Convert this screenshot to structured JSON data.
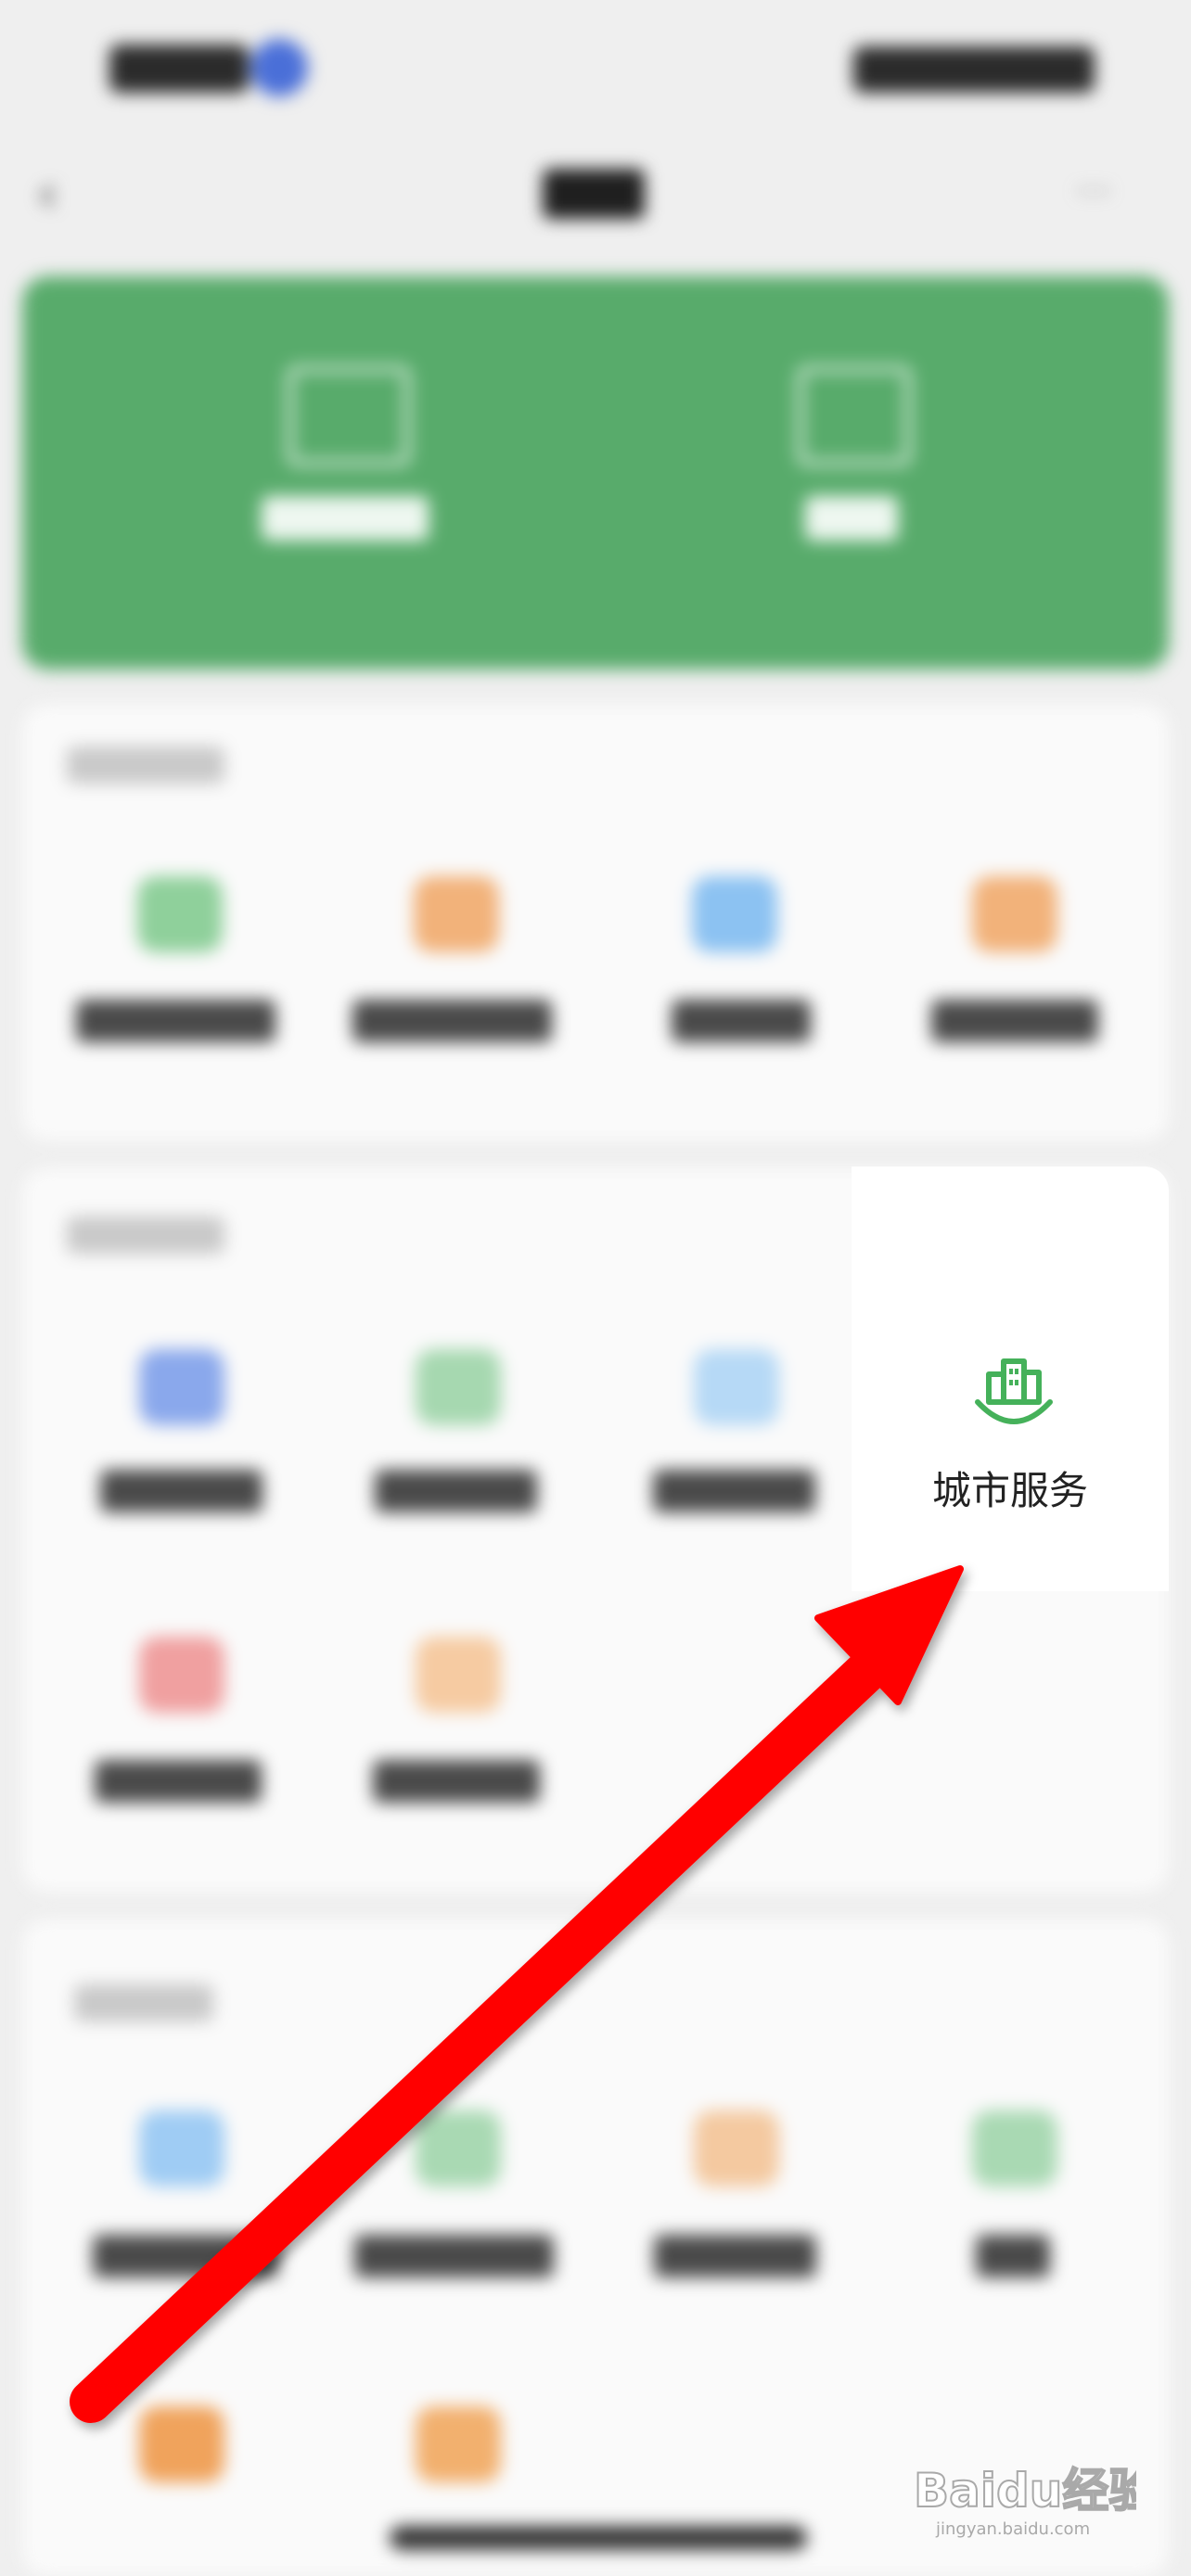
{
  "spotlight": {
    "label": "城市服务",
    "icon": "city-buildings-icon",
    "accent_color": "#45b15a"
  },
  "banner_color": "#58ab6b",
  "annotation": {
    "type": "arrow",
    "color": "#ff0000"
  },
  "watermark": {
    "brand": "Baidu经验",
    "sub": "jingyan.baidu.com"
  }
}
